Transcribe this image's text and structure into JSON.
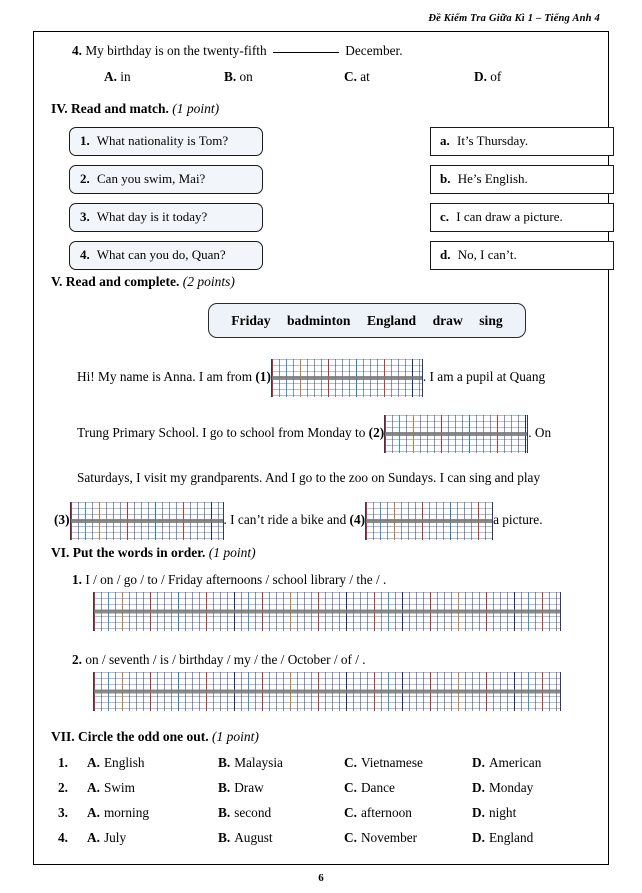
{
  "document": {
    "running_head": "Đề Kiểm Tra Giữa Kì 1 – Tiếng Anh 4",
    "page_number": "6"
  },
  "question4": {
    "number": "4.",
    "text_before": "My birthday is on the twenty-fifth",
    "text_after": "December.",
    "options": [
      {
        "label": "A.",
        "text": "in"
      },
      {
        "label": "B.",
        "text": "on"
      },
      {
        "label": "C.",
        "text": "at"
      },
      {
        "label": "D.",
        "text": "of"
      }
    ]
  },
  "section4": {
    "heading": "IV. Read and match.",
    "points": "(1 point)",
    "left": [
      {
        "key": "1.",
        "text": "What nationality is Tom?"
      },
      {
        "key": "2.",
        "text": "Can you swim, Mai?"
      },
      {
        "key": "3.",
        "text": "What day is it today?"
      },
      {
        "key": "4.",
        "text": "What can you do, Quan?"
      }
    ],
    "right": [
      {
        "key": "a.",
        "text": "It’s Thursday."
      },
      {
        "key": "b.",
        "text": "He’s English."
      },
      {
        "key": "c.",
        "text": "I can draw a picture."
      },
      {
        "key": "d.",
        "text": "No, I can’t."
      }
    ]
  },
  "section5": {
    "heading": "V. Read and complete.",
    "points": "(2 points)",
    "word_bank": [
      "Friday",
      "badminton",
      "England",
      "draw",
      "sing"
    ],
    "passage": {
      "line1_before": "Hi! My name is Anna. I am from",
      "blank1": "(1)",
      "line1_after": ". I am a pupil at Quang",
      "line2_before": "Trung Primary School. I go to school from Monday to",
      "blank2": "(2)",
      "line2_after": ". On",
      "line3": "Saturdays, I visit my grandparents. And I go to the zoo on Sundays.  I can sing and play",
      "blank3": "(3)",
      "line4_mid": ". I can’t ride a bike and",
      "blank4": "(4)",
      "line4_after": "a picture."
    }
  },
  "section6": {
    "heading": "VI. Put the words in order.",
    "points": "(1 point)",
    "items": [
      {
        "number": "1.",
        "text": "I / on / go / to / Friday afternoons / school library / the / ."
      },
      {
        "number": "2.",
        "text": "on / seventh / is / birthday / my / the / October / of / ."
      }
    ]
  },
  "section7": {
    "heading": "VII. Circle the odd one out.",
    "points": "(1 point)",
    "rows": [
      {
        "number": "1.",
        "options": [
          {
            "label": "A.",
            "text": "English"
          },
          {
            "label": "B.",
            "text": "Malaysia"
          },
          {
            "label": "C.",
            "text": "Vietnamese"
          },
          {
            "label": "D.",
            "text": "American"
          }
        ]
      },
      {
        "number": "2.",
        "options": [
          {
            "label": "A.",
            "text": "Swim"
          },
          {
            "label": "B.",
            "text": "Draw"
          },
          {
            "label": "C.",
            "text": "Dance"
          },
          {
            "label": "D.",
            "text": "Monday"
          }
        ]
      },
      {
        "number": "3.",
        "options": [
          {
            "label": "A.",
            "text": "morning"
          },
          {
            "label": "B.",
            "text": "second"
          },
          {
            "label": "C.",
            "text": "afternoon"
          },
          {
            "label": "D.",
            "text": "night"
          }
        ]
      },
      {
        "number": "4.",
        "options": [
          {
            "label": "A.",
            "text": "July"
          },
          {
            "label": "B.",
            "text": "August"
          },
          {
            "label": "C.",
            "text": "November"
          },
          {
            "label": "D.",
            "text": "England"
          }
        ]
      }
    ]
  },
  "colors": {
    "match_left_fill": "#f2f6fb",
    "word_bank_fill": "#eef3fa",
    "border": "#1a1a1a",
    "grid_blue": "#14297a",
    "grid_red": "#c43428",
    "grid_orange": "#e08c1e",
    "grid_cyan": "#2896cd"
  }
}
